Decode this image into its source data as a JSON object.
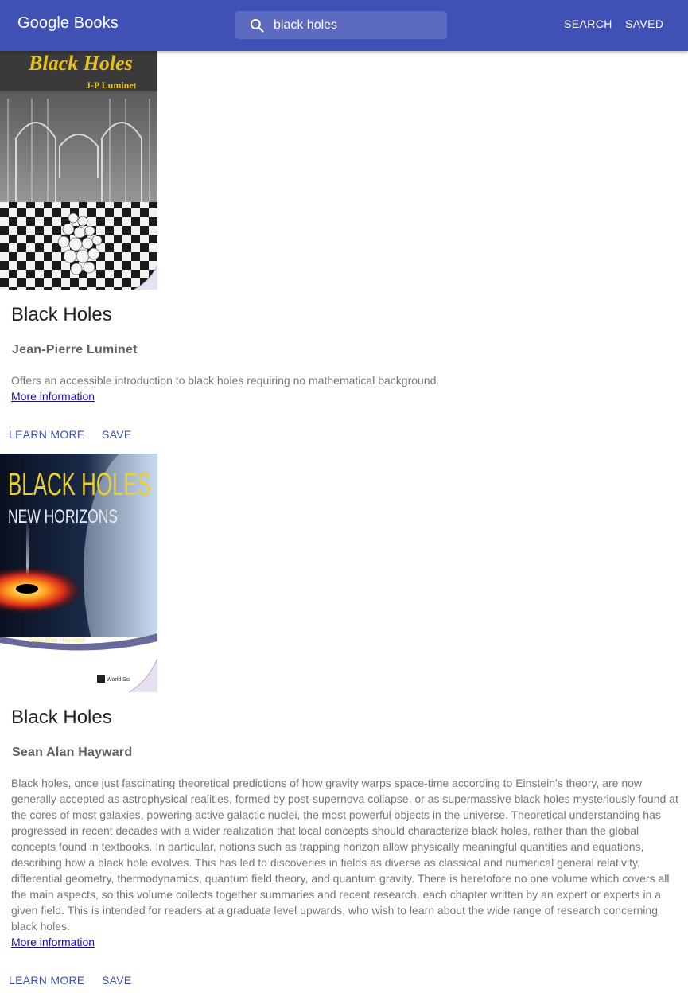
{
  "appbar": {
    "brand": "Google Books",
    "search_value": "black holes",
    "search_label": "SEARCH",
    "saved_label": "SAVED",
    "color": "#3f51b5",
    "search_bg": "#5c6bc0"
  },
  "books": [
    {
      "cover_text_1": "Black Holes",
      "cover_text_2": "J-P Luminet",
      "title": "Black Holes",
      "author": "Jean-Pierre Luminet",
      "description": "Offers an accessible introduction to black holes requiring no mathematical background.",
      "more_info": "More information",
      "learn_more": "LEARN MORE",
      "save": "SAVE"
    },
    {
      "cover_text_1": "BLACK HOLES",
      "cover_text_2": "NEW HORIZONS",
      "cover_text_3": "Sean Alan Hayward",
      "cover_text_4": "World Sci",
      "title": "Black Holes",
      "author": "Sean Alan Hayward",
      "description": "Black holes, once just fascinating theoretical predictions of how gravity warps space-time according to Einstein's theory, are now generally accepted as astrophysical realities, formed by post-supernova collapse, or as supermassive black holes mysteriously found at the cores of most galaxies, powering active galactic nuclei, the most powerful objects in the universe. Theoretical understanding has progressed in recent decades with a wider realization that local concepts should characterize black holes, rather than the global concepts found in textbooks. In particular, notions such as trapping horizon allow physically meaningful quantities and equations, describing how a black hole evolves. This has led to discoveries in fields as diverse as classical and numerical general relativity, differential geometry, thermodynamics, quantum field theory, and quantum gravity. There is heretofore no one volume which covers all the main aspects, so this volume collects together summaries and recent research, each chapter written by an expert or experts in a given field. This is intended for readers at a graduate level upwards, who wish to learn about the wide range of research concerning black holes.",
      "more_info": "More information",
      "learn_more": "LEARN MORE",
      "save": "SAVE"
    }
  ]
}
